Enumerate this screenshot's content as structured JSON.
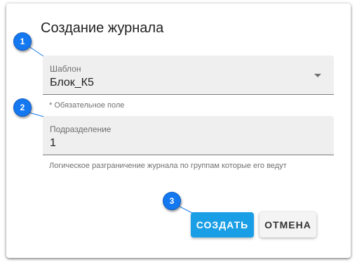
{
  "dialog": {
    "title": "Создание журнала",
    "template_field": {
      "label": "Шаблон",
      "value": "Блок_К5",
      "helper": "* Обязательное поле"
    },
    "subdivision_field": {
      "label": "Подразделение",
      "value": "1",
      "helper": "Логическое разграничение журнала по группам которые его ведут"
    },
    "buttons": {
      "create": "СОЗДАТЬ",
      "cancel": "ОТМЕНА"
    }
  },
  "callouts": [
    "1",
    "2",
    "3"
  ],
  "colors": {
    "primary_button": "#1a9ee6",
    "callout": "#1478f0",
    "field_background": "#efefef"
  },
  "icons": {
    "dropdown": "chevron-down-icon"
  }
}
